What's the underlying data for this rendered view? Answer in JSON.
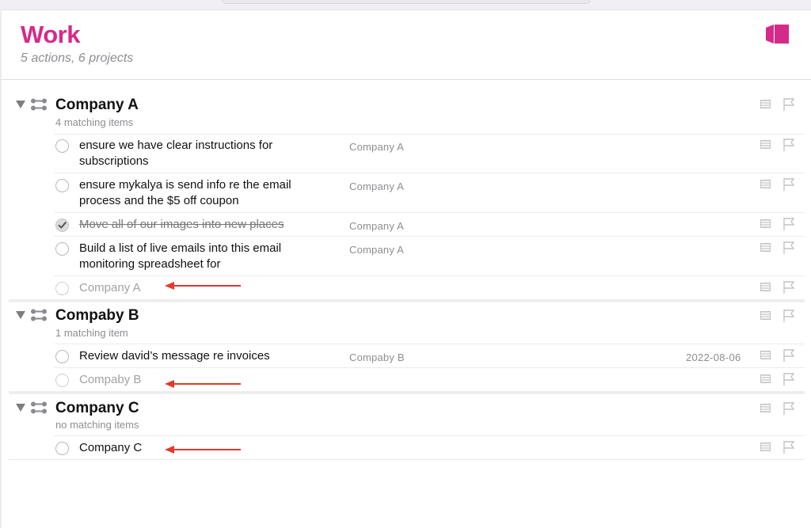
{
  "perspective": {
    "title": "Work",
    "subtitle": "5 actions, 6 projects"
  },
  "colors": {
    "accent": "#d62a8a",
    "annotation_arrow": "#e1392b",
    "muted_text": "#8e8e93"
  },
  "icons": {
    "perspective": "perspective-icon",
    "disclosure": "disclosure-triangle-icon",
    "project_type": "sequential-project-icon",
    "note": "note-icon",
    "flag": "flag-icon",
    "check": "checkmark-icon"
  },
  "projects": [
    {
      "name": "Company A",
      "count_label": "4 matching items",
      "tasks": [
        {
          "text": "ensure we have clear instructions for subscriptions",
          "project": "Company A",
          "date": "",
          "completed": false
        },
        {
          "text": "ensure mykalya is send info re the email process and the $5 off coupon",
          "project": "Company A",
          "date": "",
          "completed": false
        },
        {
          "text": "Move all of our images into new places",
          "project": "Company A",
          "date": "",
          "completed": true
        },
        {
          "text": "Build a list of live emails into this email monitoring spreadsheet for",
          "project": "Company A",
          "date": "",
          "completed": false
        }
      ],
      "new_item_label": "Company A"
    },
    {
      "name": "Compaby B",
      "count_label": "1 matching item",
      "tasks": [
        {
          "text": "Review david’s message re invoices",
          "project": "Compaby B",
          "date": "2022-08-06",
          "completed": false
        }
      ],
      "new_item_label": "Compaby B"
    },
    {
      "name": "Company C",
      "count_label": "no matching items",
      "tasks": [],
      "new_item_label": "Company C"
    }
  ]
}
